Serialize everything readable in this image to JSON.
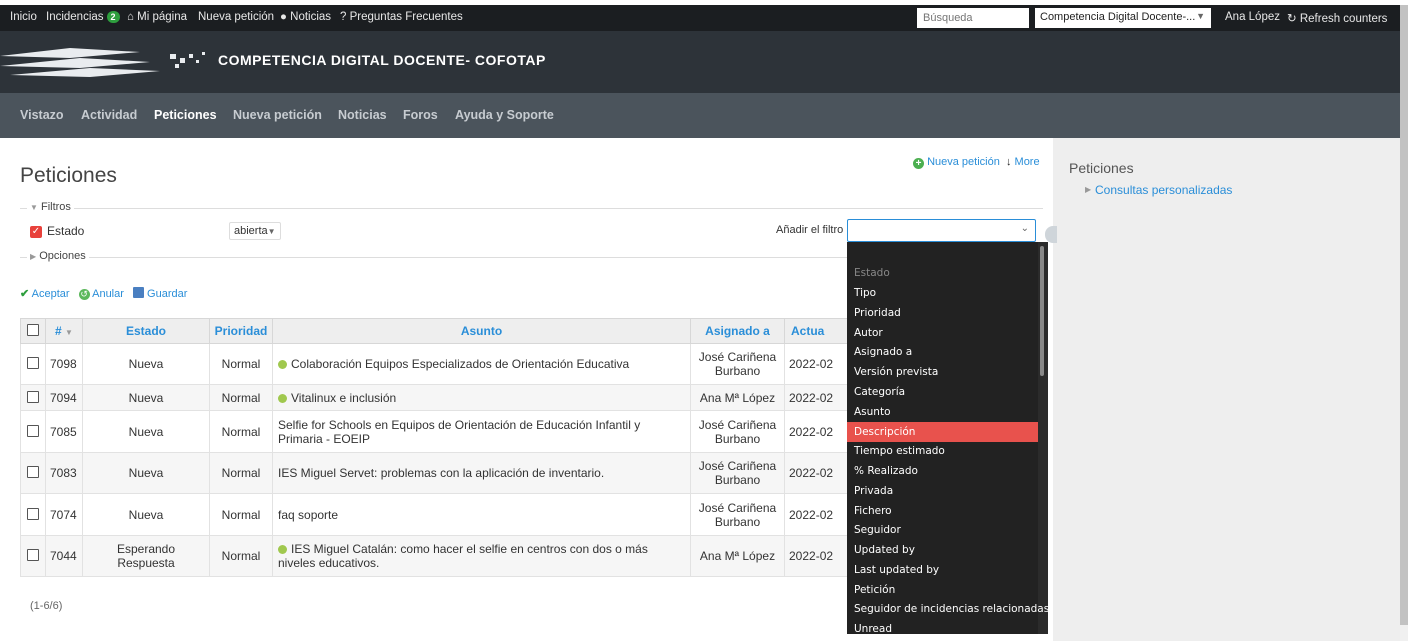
{
  "topbar": {
    "links": [
      "Inicio",
      "Incidencias",
      "Mi página",
      "Nueva petición",
      "Noticias",
      "Preguntas Frecuentes"
    ],
    "incidencias_badge": "2",
    "search_placeholder": "Búsqueda",
    "project_select": "Competencia Digital Docente-...",
    "user": "Ana López",
    "refresh": "Refresh counters"
  },
  "header": {
    "title": "COMPETENCIA DIGITAL DOCENTE- COFOTAP"
  },
  "mainmenu": [
    "Vistazo",
    "Actividad",
    "Peticiones",
    "Nueva petición",
    "Noticias",
    "Foros",
    "Ayuda y Soporte"
  ],
  "mainmenu_selected": "Peticiones",
  "page": {
    "title": "Peticiones",
    "new_issue": "Nueva petición",
    "more": "More"
  },
  "filters": {
    "legend": "Filtros",
    "estado_label": "Estado",
    "estado_value": "abierta",
    "add_filter_label": "Añadir el filtro",
    "options_legend": "Opciones"
  },
  "actions": {
    "apply": "Aceptar",
    "clear": "Anular",
    "save": "Guardar"
  },
  "table": {
    "headers": [
      "#",
      "Estado",
      "Prioridad",
      "Asunto",
      "Asignado a",
      "Actua"
    ],
    "rows": [
      {
        "id": "7098",
        "estado": "Nueva",
        "prioridad": "Normal",
        "asunto": "Colaboración Equipos Especializados de Orientación Educativa",
        "dot": true,
        "asignado": "José Cariñena Burbano",
        "actualizado": "2022-02"
      },
      {
        "id": "7094",
        "estado": "Nueva",
        "prioridad": "Normal",
        "asunto": "Vitalinux e inclusión",
        "dot": true,
        "asignado": "Ana Mª López",
        "actualizado": "2022-02"
      },
      {
        "id": "7085",
        "estado": "Nueva",
        "prioridad": "Normal",
        "asunto": "Selfie for Schools en Equipos de Orientación de Educación Infantil y Primaria - EOEIP",
        "dot": false,
        "asignado": "José Cariñena Burbano",
        "actualizado": "2022-02"
      },
      {
        "id": "7083",
        "estado": "Nueva",
        "prioridad": "Normal",
        "asunto": "IES Miguel Servet: problemas con la aplicación de inventario.",
        "dot": false,
        "asignado": "José Cariñena Burbano",
        "actualizado": "2022-02"
      },
      {
        "id": "7074",
        "estado": "Nueva",
        "prioridad": "Normal",
        "asunto": "faq soporte",
        "dot": false,
        "asignado": "José Cariñena Burbano",
        "actualizado": "2022-02"
      },
      {
        "id": "7044",
        "estado": "Esperando Respuesta",
        "prioridad": "Normal",
        "asunto": "IES Miguel Catalán: como hacer el selfie en centros con dos o más niveles educativos.",
        "dot": true,
        "asignado": "Ana Mª López",
        "actualizado": "2022-02"
      }
    ]
  },
  "pager": "(1-6/6)",
  "dropdown": {
    "options": [
      "Estado",
      "Tipo",
      "Prioridad",
      "Autor",
      "Asignado a",
      "Versión prevista",
      "Categoría",
      "Asunto",
      "Descripción",
      "Tiempo estimado",
      "% Realizado",
      "Privada",
      "Fichero",
      "Seguidor",
      "Updated by",
      "Last updated by",
      "Petición",
      "Seguidor de incidencias relacionadas",
      "Unread"
    ],
    "disabled": "Estado",
    "highlighted": "Descripción"
  },
  "sidebar": {
    "title": "Peticiones",
    "link": "Consultas personalizadas"
  },
  "colors": {
    "accent": "#2a8ed8",
    "highlight": "#e8524d",
    "badge": "#2e9e3e"
  }
}
